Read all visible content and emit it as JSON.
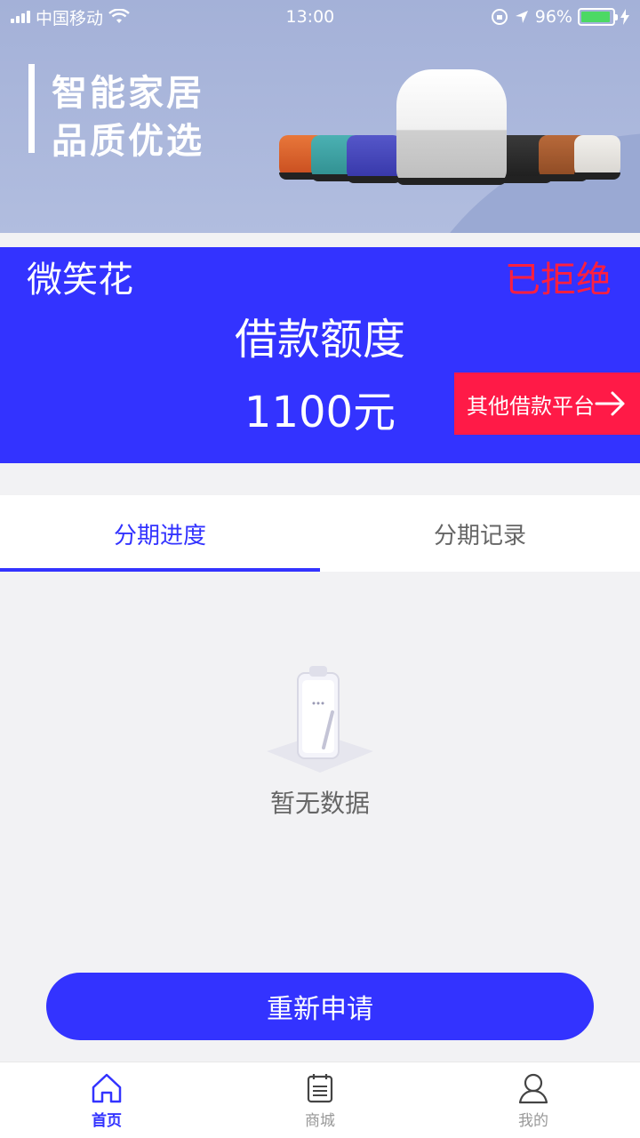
{
  "status_bar": {
    "carrier": "中国移动",
    "time": "13:00",
    "battery": "96%",
    "battery_color": "#4cd964"
  },
  "banner": {
    "line1": "智能家居",
    "line2": "品质优选"
  },
  "loan": {
    "app_name": "微笑花",
    "status": "已拒绝",
    "quota_label": "借款额度",
    "quota_value": "1100元",
    "other_platform": "其他借款平台",
    "accent": "#3333ff",
    "alert": "#ff1a47"
  },
  "tabs": [
    {
      "label": "分期进度",
      "active": true
    },
    {
      "label": "分期记录",
      "active": false
    }
  ],
  "empty": {
    "text": "暂无数据",
    "icon": "clipboard-empty-icon"
  },
  "reapply": {
    "label": "重新申请"
  },
  "nav": [
    {
      "label": "首页",
      "icon": "home-icon",
      "active": true
    },
    {
      "label": "商城",
      "icon": "calendar-icon",
      "active": false
    },
    {
      "label": "我的",
      "icon": "user-icon",
      "active": false
    }
  ]
}
